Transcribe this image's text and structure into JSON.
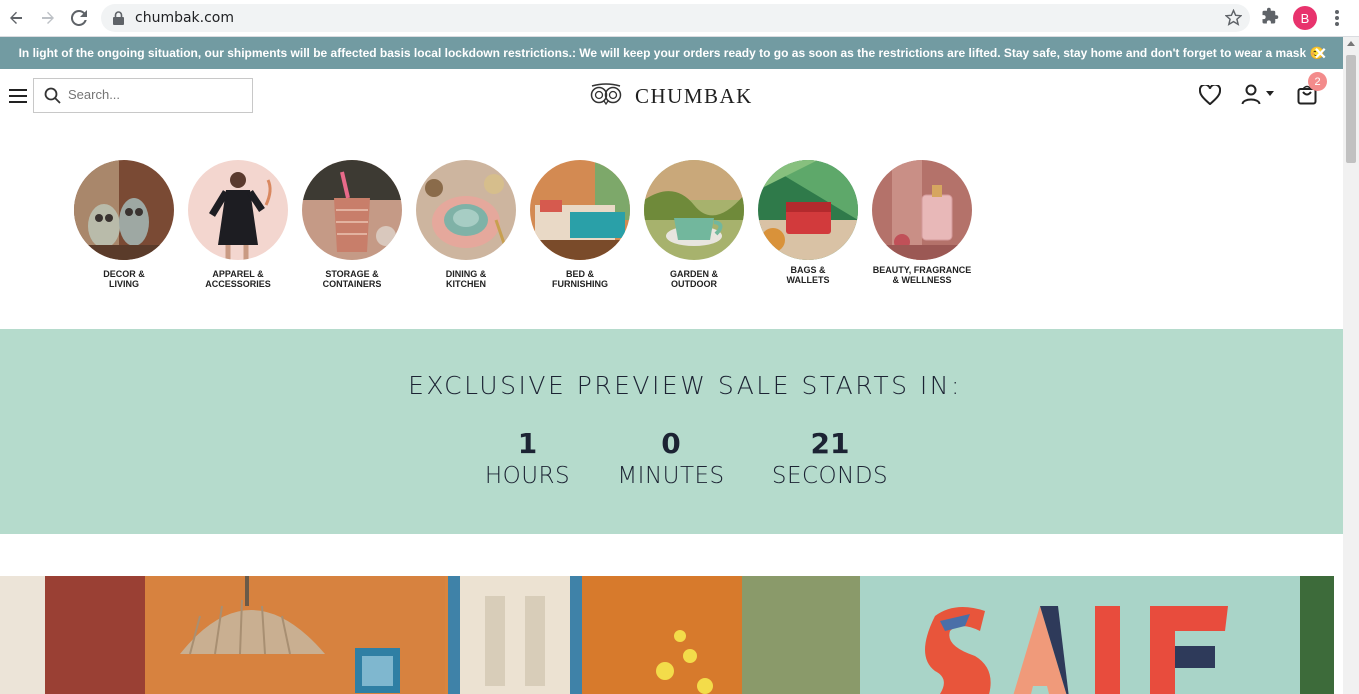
{
  "browser": {
    "url": "chumbak.com",
    "profile_initial": "B"
  },
  "announcement": {
    "text": "In light of the ongoing situation, our shipments will be affected basis local lockdown restrictions.: We will keep your orders ready to go as soon as the restrictions are lifted. Stay safe, stay home and don't forget to wear a mask 😊",
    "close": "✕"
  },
  "header": {
    "search_placeholder": "Search...",
    "logo_text": "CHUMBAK",
    "cart_count": "2"
  },
  "categories": [
    {
      "label": "DECOR &\nLIVING"
    },
    {
      "label": "APPAREL &\nACCESSORIES"
    },
    {
      "label": "STORAGE &\nCONTAINERS"
    },
    {
      "label": "DINING &\nKITCHEN"
    },
    {
      "label": "BED &\nFURNISHING"
    },
    {
      "label": "GARDEN &\nOUTDOOR"
    },
    {
      "label": "BAGS &\nWALLETS"
    },
    {
      "label": "BEAUTY, FRAGRANCE\n& WELLNESS"
    }
  ],
  "sale": {
    "title": "EXCLUSIVE PREVIEW SALE STARTS IN:",
    "hours": "1",
    "hours_label": "HOURS",
    "minutes": "0",
    "minutes_label": "MINUTES",
    "seconds": "21",
    "seconds_label": "SECONDS"
  },
  "hero": {
    "text": "SALE"
  }
}
